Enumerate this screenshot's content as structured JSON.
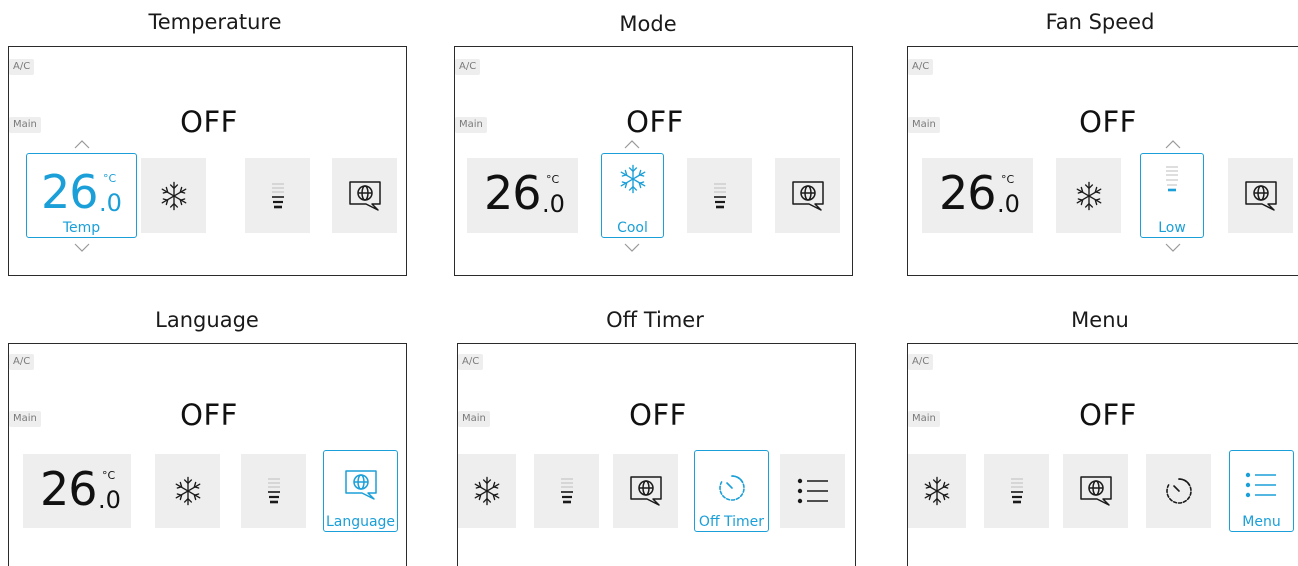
{
  "colors": {
    "accent": "#1a9fd8",
    "tile_bg": "#eeeeef",
    "border": "#2b2b2b"
  },
  "panels": [
    {
      "caption": "Temperature",
      "badge_ac": "A/C",
      "badge_main": "Main",
      "status": "OFF",
      "temp_int": "26",
      "temp_unit": "°C",
      "temp_dec": ".0",
      "selected_label": "Temp"
    },
    {
      "caption": "Mode",
      "badge_ac": "A/C",
      "badge_main": "Main",
      "status": "OFF",
      "temp_int": "26",
      "temp_unit": "°C",
      "temp_dec": ".0",
      "selected_label": "Cool"
    },
    {
      "caption": "Fan Speed",
      "badge_ac": "A/C",
      "badge_main": "Main",
      "status": "OFF",
      "temp_int": "26",
      "temp_unit": "°C",
      "temp_dec": ".0",
      "selected_label": "Low"
    },
    {
      "caption": "Language",
      "badge_ac": "A/C",
      "badge_main": "Main",
      "status": "OFF",
      "temp_int": "26",
      "temp_unit": "°C",
      "temp_dec": ".0",
      "selected_label": "Language"
    },
    {
      "caption": "Off Timer",
      "badge_ac": "A/C",
      "badge_main": "Main",
      "status": "OFF",
      "selected_label": "Off Timer"
    },
    {
      "caption": "Menu",
      "badge_ac": "A/C",
      "badge_main": "Main",
      "status": "OFF",
      "selected_label": "Menu"
    }
  ],
  "icons": [
    "snowflake-icon",
    "fan-level-icon",
    "language-globe-icon",
    "timer-icon",
    "menu-list-icon",
    "chevron-up-icon",
    "chevron-down-icon"
  ]
}
